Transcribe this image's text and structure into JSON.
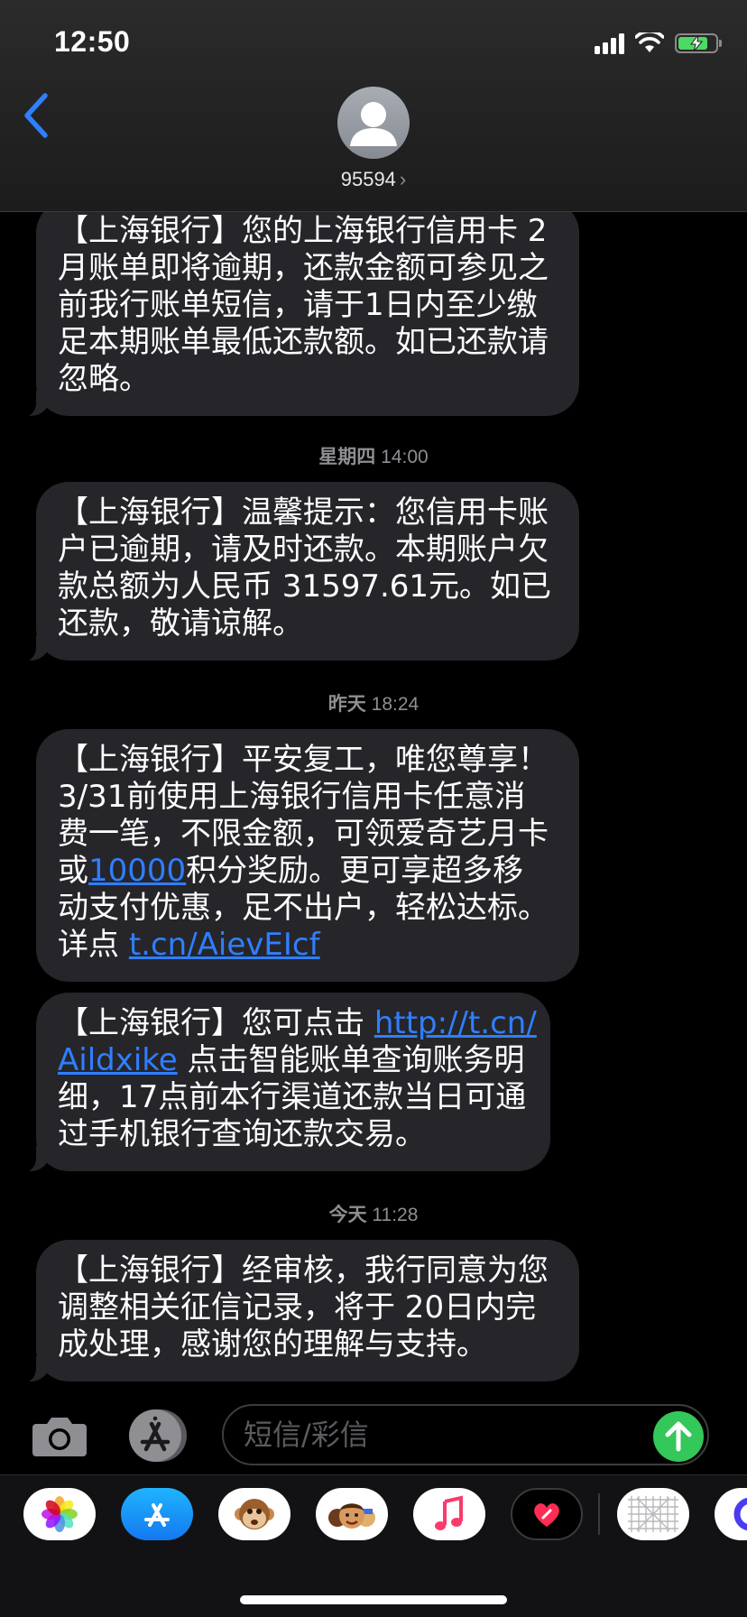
{
  "status_bar": {
    "time": "12:50",
    "battery_level": 0.8,
    "battery_color": "#4cd964"
  },
  "header": {
    "back_icon": "chevron-left-icon",
    "contact_name": "95594",
    "contact_chevron": "›",
    "accent_color": "#2f7fff"
  },
  "messages": [
    {
      "lines": [
        "【上海银行】您的上海银行信用卡 2",
        "月账单即将逾期，还款金额可参见之",
        "前我行账单短信，请于1日内至少缴",
        "足本期账单最低还款额。如已还款请",
        "忽略。"
      ]
    },
    {
      "timestamp_day": "星期四",
      "timestamp_time": "14:00",
      "lines": [
        "【上海银行】温馨提示：您信用卡账",
        "户已逾期，请及时还款。本期账户欠",
        "款总额为人民币 31597.61元。如已",
        "还款，敬请谅解。"
      ]
    },
    {
      "timestamp_day": "昨天",
      "timestamp_time": "18:24",
      "line1": "【上海银行】平安复工，唯您尊享！",
      "line2": "3/31前使用上海银行信用卡任意消",
      "line3": "费一笔，不限金额，可领爱奇艺月卡",
      "line4_pre": "或",
      "line4_link": "10000",
      "line4_post": "积分奖励。更可享超多移",
      "line5": "动支付优惠，足不出户，轻松达标。",
      "line6_pre": "详点 ",
      "line6_link": "t.cn/AievEIcf"
    },
    {
      "line1_pre": "【上海银行】您可点击 ",
      "line1_link": "http://t.cn/",
      "line2_link": "Aildxike",
      "line2_post": " 点击智能账单查询账务明",
      "line3": "细，17点前本行渠道还款当日可通",
      "line4": "过手机银行查询还款交易。"
    },
    {
      "timestamp_day": "今天",
      "timestamp_time": "11:28",
      "lines": [
        "【上海银行】经审核，我行同意为您",
        "调整相关征信记录，将于 20日内完",
        "成处理，感谢您的理解与支持。"
      ]
    }
  ],
  "compose": {
    "camera_icon": "camera-icon",
    "apps_icon": "app-store-icon",
    "placeholder": "短信/彩信",
    "send_icon": "arrow-up-icon",
    "send_color": "#34c759"
  },
  "app_drawer": [
    {
      "name": "photos-app-icon"
    },
    {
      "name": "app-store-app-icon"
    },
    {
      "name": "animoji-app-icon"
    },
    {
      "name": "memoji-app-icon"
    },
    {
      "name": "music-app-icon"
    },
    {
      "name": "digital-touch-app-icon"
    },
    {
      "name": "stickers-app-icon"
    },
    {
      "name": "more-app-icon"
    }
  ]
}
